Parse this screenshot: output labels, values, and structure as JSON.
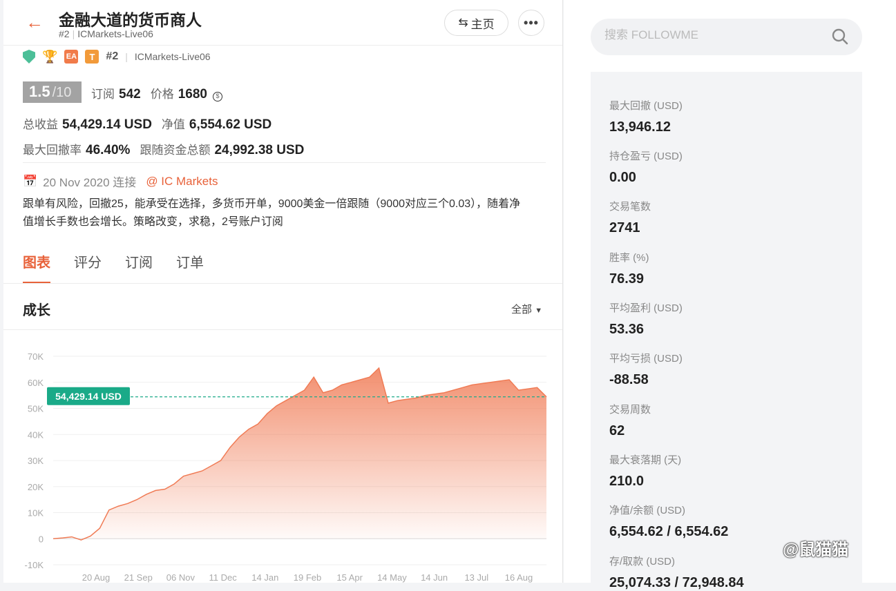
{
  "header": {
    "title": "金融大道的货币商人",
    "rank": "#2",
    "account": "ICMarkets-Live06",
    "home_label": "主页",
    "more_label": "•••"
  },
  "badges": {
    "ea_label": "EA",
    "t_label": "T",
    "rank": "#2",
    "account": "ICMarkets-Live06"
  },
  "score": {
    "value": "1.5",
    "max": "/10"
  },
  "subscriptions": {
    "label": "订阅",
    "value": "542"
  },
  "price": {
    "label": "价格",
    "value": "1680"
  },
  "total_profit": {
    "label": "总收益",
    "value": "54,429.14 USD"
  },
  "equity": {
    "label": "净值",
    "value": "6,554.62 USD"
  },
  "max_drawdown_rate": {
    "label": "最大回撤率",
    "value": "46.40%"
  },
  "follow_funds": {
    "label": "跟随资金总额",
    "value": "24,992.38 USD"
  },
  "since": {
    "date": "20 Nov 2020 连接",
    "broker": "@ IC Markets"
  },
  "description": "跟单有风险，回撤25，能承受在选择，多货币开单，9000美金一倍跟随（9000对应三个0.03），随着净值增长手数也会增长。策略改变，求稳，2号账户订阅",
  "tabs": [
    "图表",
    "评分",
    "订阅",
    "订单"
  ],
  "section_title": "成长",
  "filter_label": "全部",
  "chart_data": {
    "type": "area",
    "title": "成长",
    "x_tick_labels": [
      "20 Aug",
      "21 Sep",
      "06 Nov",
      "11 Dec",
      "14 Jan",
      "19 Feb",
      "15 Apr",
      "14 May",
      "14 Jun",
      "13 Jul",
      "16 Aug"
    ],
    "y_tick_labels": [
      "70K",
      "60K",
      "50K",
      "40K",
      "30K",
      "20K",
      "10K",
      "0",
      "-10K"
    ],
    "ylim": [
      -10000,
      70000
    ],
    "current_value_label": "54,429.14 USD",
    "current_value": 54429.14,
    "series": [
      {
        "values": [
          0,
          300,
          700,
          -500,
          1000,
          4000,
          11000,
          12500,
          13500,
          15000,
          17000,
          18500,
          19000,
          21000,
          24000,
          25000,
          26000,
          28000,
          30000,
          35000,
          39000,
          42000,
          44000,
          48000,
          51000,
          53000,
          55000,
          57000,
          62000,
          56000,
          57000,
          59000,
          60000,
          61000,
          62000,
          65500,
          52000,
          53000,
          53500,
          54000,
          55000,
          55500,
          56000,
          57000,
          58000,
          59000,
          59500,
          60000,
          60500,
          61000,
          57000,
          57500,
          58000,
          54429
        ]
      }
    ],
    "grid": true,
    "accent_color": "#f07b55",
    "label_color": "#1aaa88"
  },
  "search": {
    "placeholder": "搜索 FOLLOWME"
  },
  "stats": [
    {
      "label": "最大回撤 (USD)",
      "value": "13,946.12"
    },
    {
      "label": "持仓盈亏 (USD)",
      "value": "0.00"
    },
    {
      "label": "交易笔数",
      "value": "2741"
    },
    {
      "label": "胜率 (%)",
      "value": "76.39"
    },
    {
      "label": "平均盈利 (USD)",
      "value": "53.36"
    },
    {
      "label": "平均亏损 (USD)",
      "value": "-88.58"
    },
    {
      "label": "交易周数",
      "value": "62"
    },
    {
      "label": "最大衰落期 (天)",
      "value": "210.0"
    },
    {
      "label": "净值/余额 (USD)",
      "value": "6,554.62 / 6,554.62"
    },
    {
      "label": "存/取款 (USD)",
      "value": "25,074.33 / 72,948.84"
    }
  ],
  "watermark": "@鼠猫猫"
}
